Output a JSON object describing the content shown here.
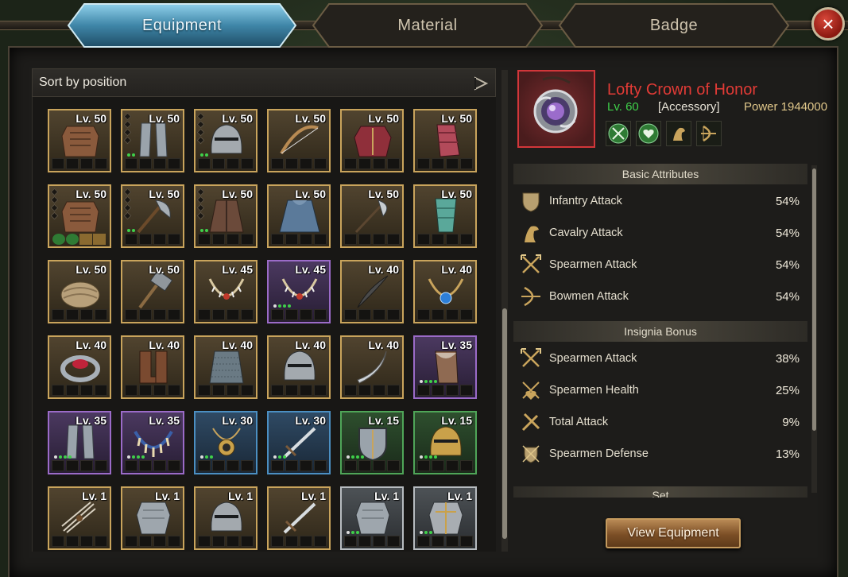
{
  "tabs": [
    {
      "label": "Equipment",
      "active": true
    },
    {
      "label": "Material",
      "active": false
    },
    {
      "label": "Badge",
      "active": false
    }
  ],
  "close_label": "×",
  "sort": {
    "label": "Sort by position"
  },
  "items": [
    {
      "lv": "Lv. 50",
      "rarity": "gold",
      "art": "armor",
      "pips": 0,
      "dots": 0
    },
    {
      "lv": "Lv. 50",
      "rarity": "gold",
      "art": "greaves",
      "pips": 4,
      "dots": 2
    },
    {
      "lv": "Lv. 50",
      "rarity": "gold",
      "art": "helmet",
      "pips": 4,
      "dots": 2
    },
    {
      "lv": "Lv. 50",
      "rarity": "gold",
      "art": "bow",
      "pips": 0,
      "dots": 0
    },
    {
      "lv": "Lv. 50",
      "rarity": "gold",
      "art": "redarmor",
      "pips": 0,
      "dots": 0
    },
    {
      "lv": "Lv. 50",
      "rarity": "gold",
      "art": "bracer",
      "pips": 0,
      "dots": 0
    },
    {
      "lv": "Lv. 50",
      "rarity": "gold",
      "art": "armor",
      "pips": 4,
      "dots": 0,
      "badges": true
    },
    {
      "lv": "Lv. 50",
      "rarity": "gold",
      "art": "axe",
      "pips": 4,
      "dots": 2
    },
    {
      "lv": "Lv. 50",
      "rarity": "gold",
      "art": "robe",
      "pips": 4,
      "dots": 2
    },
    {
      "lv": "Lv. 50",
      "rarity": "gold",
      "art": "cloak",
      "pips": 0,
      "dots": 0
    },
    {
      "lv": "Lv. 50",
      "rarity": "gold",
      "art": "glaive",
      "pips": 0,
      "dots": 0
    },
    {
      "lv": "Lv. 50",
      "rarity": "gold",
      "art": "tealgreave",
      "pips": 0,
      "dots": 0
    },
    {
      "lv": "Lv. 50",
      "rarity": "gold",
      "art": "turban",
      "pips": 0,
      "dots": 0
    },
    {
      "lv": "Lv. 50",
      "rarity": "gold",
      "art": "hammer",
      "pips": 0,
      "dots": 0
    },
    {
      "lv": "Lv. 45",
      "rarity": "gold",
      "art": "necklace",
      "pips": 0,
      "dots": 0
    },
    {
      "lv": "Lv. 45",
      "rarity": "purple",
      "art": "necklace",
      "pips": 0,
      "dots": 4
    },
    {
      "lv": "Lv. 40",
      "rarity": "gold",
      "art": "feather",
      "pips": 0,
      "dots": 0
    },
    {
      "lv": "Lv. 40",
      "rarity": "gold",
      "art": "bluenecklace",
      "pips": 0,
      "dots": 0
    },
    {
      "lv": "Lv. 40",
      "rarity": "gold",
      "art": "ring",
      "pips": 0,
      "dots": 0
    },
    {
      "lv": "Lv. 40",
      "rarity": "gold",
      "art": "boots",
      "pips": 0,
      "dots": 0
    },
    {
      "lv": "Lv. 40",
      "rarity": "gold",
      "art": "chain",
      "pips": 0,
      "dots": 0
    },
    {
      "lv": "Lv. 40",
      "rarity": "gold",
      "art": "helmet",
      "pips": 0,
      "dots": 0
    },
    {
      "lv": "Lv. 40",
      "rarity": "gold",
      "art": "sabre",
      "pips": 0,
      "dots": 0
    },
    {
      "lv": "Lv. 35",
      "rarity": "purple",
      "art": "furleg",
      "pips": 0,
      "dots": 4
    },
    {
      "lv": "Lv. 35",
      "rarity": "purple",
      "art": "greaves",
      "pips": 0,
      "dots": 4
    },
    {
      "lv": "Lv. 35",
      "rarity": "purple",
      "art": "clawneck",
      "pips": 0,
      "dots": 4
    },
    {
      "lv": "Lv. 30",
      "rarity": "blue",
      "art": "amulet",
      "pips": 0,
      "dots": 3
    },
    {
      "lv": "Lv. 30",
      "rarity": "blue",
      "art": "sword",
      "pips": 0,
      "dots": 3
    },
    {
      "lv": "Lv. 15",
      "rarity": "green",
      "art": "shield",
      "pips": 0,
      "dots": 4
    },
    {
      "lv": "Lv. 15",
      "rarity": "green",
      "art": "goldhelm",
      "pips": 0,
      "dots": 4
    },
    {
      "lv": "Lv. 1",
      "rarity": "gold",
      "art": "bundle",
      "pips": 0,
      "dots": 0
    },
    {
      "lv": "Lv. 1",
      "rarity": "gold",
      "art": "plate",
      "pips": 0,
      "dots": 0
    },
    {
      "lv": "Lv. 1",
      "rarity": "gold",
      "art": "helmet",
      "pips": 0,
      "dots": 0
    },
    {
      "lv": "Lv. 1",
      "rarity": "gold",
      "art": "sword",
      "pips": 0,
      "dots": 0
    },
    {
      "lv": "Lv. 1",
      "rarity": "silver",
      "art": "plate",
      "pips": 0,
      "dots": 3
    },
    {
      "lv": "Lv. 1",
      "rarity": "silver",
      "art": "goldplate",
      "pips": 0,
      "dots": 3
    }
  ],
  "detail": {
    "name": "Lofty Crown of Honor",
    "level": "Lv. 60",
    "category": "[Accessory]",
    "power": "Power 1944000",
    "name_color": "#e23b36",
    "badges": [
      "spear-badge-icon",
      "heart-badge-icon",
      "horse-badge-icon",
      "bow-badge-icon"
    ]
  },
  "sections": {
    "basic": "Basic Attributes",
    "insignia": "Insignia Bonus",
    "set": "Set"
  },
  "basic_attrs": [
    {
      "icon": "shield-icon",
      "name": "Infantry Attack",
      "value": "54%"
    },
    {
      "icon": "horse-icon",
      "name": "Cavalry Attack",
      "value": "54%"
    },
    {
      "icon": "crossed-spears-icon",
      "name": "Spearmen Attack",
      "value": "54%"
    },
    {
      "icon": "bow-icon",
      "name": "Bowmen Attack",
      "value": "54%"
    }
  ],
  "insignia_attrs": [
    {
      "icon": "crossed-spears-icon",
      "name": "Spearmen Attack",
      "value": "38%"
    },
    {
      "icon": "spear-heart-icon",
      "name": "Spearmen Health",
      "value": "25%"
    },
    {
      "icon": "crossed-swords-icon",
      "name": "Total Attack",
      "value": "9%"
    },
    {
      "icon": "spear-shield-icon",
      "name": "Spearmen Defense",
      "value": "13%"
    }
  ],
  "view_button": "View Equipment"
}
